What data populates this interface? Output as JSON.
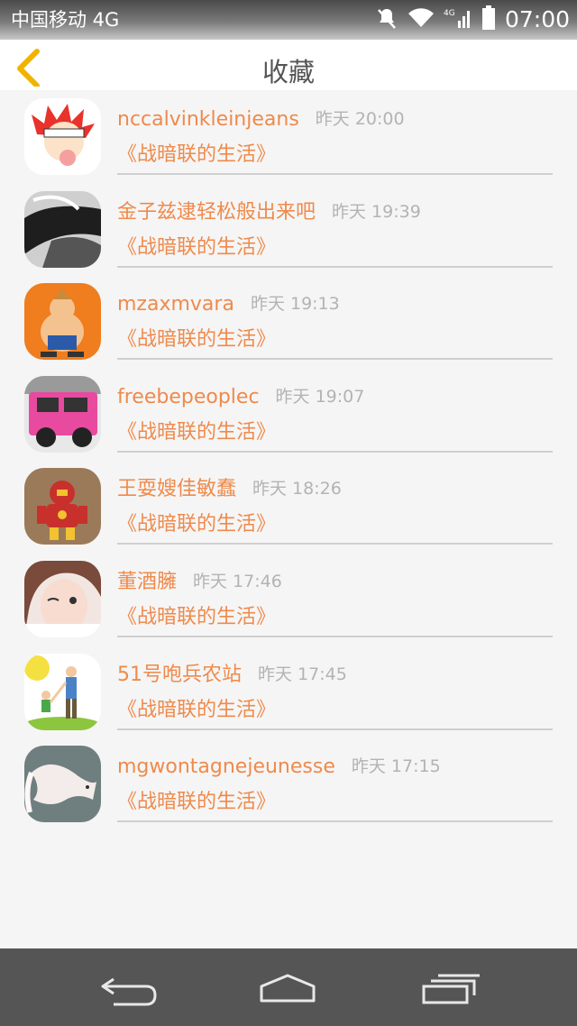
{
  "status_bar": {
    "carrier": "中国移动 4G",
    "time": "07:00"
  },
  "header": {
    "title": "收藏",
    "back_icon": "chevron-left-icon"
  },
  "favorites": [
    {
      "name": "nccalvinkleinjeans",
      "time": "昨天 20:00",
      "title": "《战暗联的生活》"
    },
    {
      "name": "金子兹逮轻松般出来吧",
      "time": "昨天 19:39",
      "title": "《战暗联的生活》"
    },
    {
      "name": "mzaxmvara",
      "time": "昨天 19:13",
      "title": "《战暗联的生活》"
    },
    {
      "name": "freebepeoplec",
      "time": "昨天 19:07",
      "title": "《战暗联的生活》"
    },
    {
      "name": "王耍嫂佳敏蠢",
      "time": "昨天 18:26",
      "title": "《战暗联的生活》"
    },
    {
      "name": "董酒臃",
      "time": "昨天 17:46",
      "title": "《战暗联的生活》"
    },
    {
      "name": "51号咆兵农站",
      "time": "昨天 17:45",
      "title": "《战暗联的生活》"
    },
    {
      "name": "mgwontagnejeunesse",
      "time": "昨天 17:15",
      "title": "《战暗联的生活》"
    }
  ],
  "colors": {
    "accent": "#ef8a4b",
    "back_icon": "#f0b400",
    "time_text": "#b3b3b3",
    "nav_bar": "#555555"
  },
  "nav_bar": {
    "icons": [
      "back-icon",
      "home-icon",
      "recent-apps-icon"
    ]
  }
}
